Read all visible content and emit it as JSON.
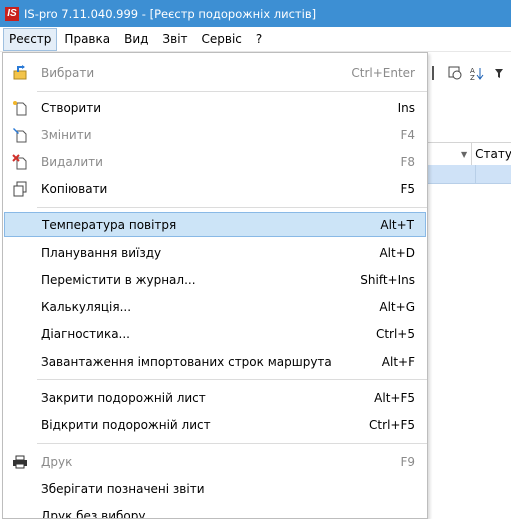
{
  "window": {
    "title": "IS-pro 7.11.040.999 - [Реєстр подорожніх листів]",
    "logo_text": "IS"
  },
  "menubar": {
    "items": [
      {
        "label": "Реєстр"
      },
      {
        "label": "Правка"
      },
      {
        "label": "Вид"
      },
      {
        "label": "Звіт"
      },
      {
        "label": "Сервіс"
      },
      {
        "label": "?"
      }
    ]
  },
  "grid": {
    "column_header": "Статус"
  },
  "menu": {
    "items": [
      {
        "label": "Вибрати",
        "shortcut": "Ctrl+Enter",
        "icon": "select-arrow-icon",
        "disabled": true
      },
      {
        "label": "Створити",
        "shortcut": "Ins",
        "icon": "new-document-icon",
        "disabled": false
      },
      {
        "label": "Змінити",
        "shortcut": "F4",
        "icon": "edit-document-icon",
        "disabled": true
      },
      {
        "label": "Видалити",
        "shortcut": "F8",
        "icon": "delete-document-icon",
        "disabled": true
      },
      {
        "label": "Копіювати",
        "shortcut": "F5",
        "icon": "copy-icon",
        "disabled": false
      },
      {
        "label": "Температура повітря",
        "shortcut": "Alt+T",
        "icon": "",
        "disabled": false,
        "highlighted": true
      },
      {
        "label": "Планування виїзду",
        "shortcut": "Alt+D",
        "icon": "",
        "disabled": false
      },
      {
        "label": "Перемістити в журнал...",
        "shortcut": "Shift+Ins",
        "icon": "",
        "disabled": false
      },
      {
        "label": "Калькуляція...",
        "shortcut": "Alt+G",
        "icon": "",
        "disabled": false
      },
      {
        "label": "Діагностика...",
        "shortcut": "Ctrl+5",
        "icon": "",
        "disabled": false
      },
      {
        "label": "Завантаження імпортованих строк маршрута",
        "shortcut": "Alt+F",
        "icon": "",
        "disabled": false
      },
      {
        "label": "Закрити подорожній лист",
        "shortcut": "Alt+F5",
        "icon": "",
        "disabled": false
      },
      {
        "label": "Відкрити подорожній лист",
        "shortcut": "Ctrl+F5",
        "icon": "",
        "disabled": false
      },
      {
        "label": "Друк",
        "shortcut": "F9",
        "icon": "printer-icon",
        "disabled": true
      },
      {
        "label": "Зберігати позначені звіти",
        "shortcut": "",
        "icon": "",
        "disabled": false
      },
      {
        "label": "Друк без вибору",
        "shortcut": "",
        "icon": "",
        "disabled": false
      }
    ]
  },
  "colors": {
    "titlebar": "#3d8fd3",
    "highlight": "#cce4f7",
    "disabled_text": "#8a8a8a"
  }
}
